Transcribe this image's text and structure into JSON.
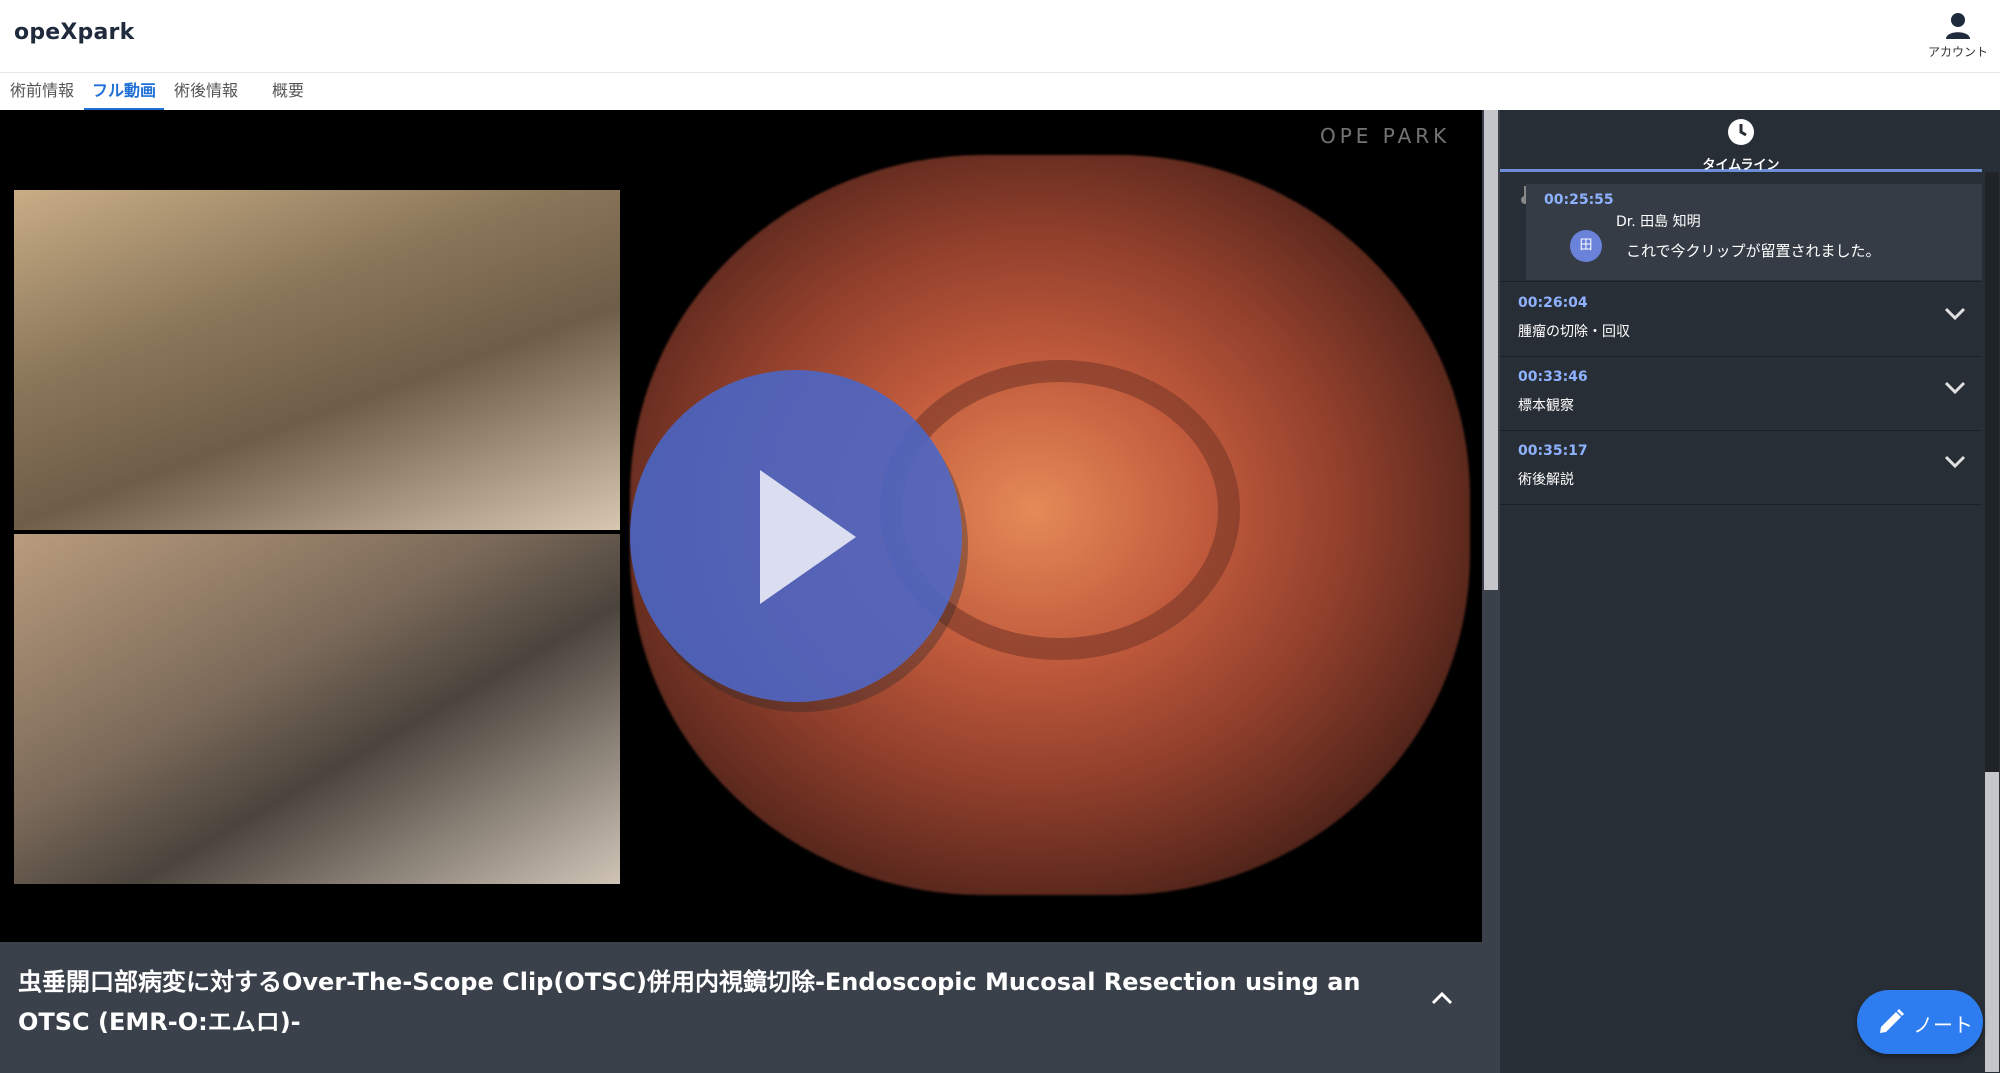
{
  "app": {
    "logo": "opeXpark"
  },
  "header": {
    "account_label": "アカウント"
  },
  "tabs": [
    {
      "label": "術前情報",
      "active": false
    },
    {
      "label": "フル動画",
      "active": true
    },
    {
      "label": "術後情報",
      "active": false
    },
    {
      "label": "概要",
      "active": false
    }
  ],
  "video": {
    "watermark": "OPE PARK",
    "title": "虫垂開口部病変に対するOver-The-Scope Clip(OTSC)併用内視鏡切除-Endoscopic Mucosal Resection using an OTSC (EMR-O:エムロ)-"
  },
  "timeline": {
    "header_label": "タイムライン",
    "open_entry": {
      "time": "00:25:55",
      "author": "Dr. 田島 知明",
      "avatar": "田",
      "text": "これで今クリップが留置されました。"
    },
    "entries": [
      {
        "time": "00:26:04",
        "label": "腫瘤の切除・回収"
      },
      {
        "time": "00:33:46",
        "label": "標本観察"
      },
      {
        "time": "00:35:17",
        "label": "術後解説"
      }
    ]
  },
  "note_button": {
    "label": "ノート"
  },
  "colors": {
    "accent": "#1e6fd6",
    "panel_bg": "#282e36",
    "time_text": "#8fb2ff",
    "play_button": "#4967c8",
    "note_button": "#2d7df0"
  }
}
